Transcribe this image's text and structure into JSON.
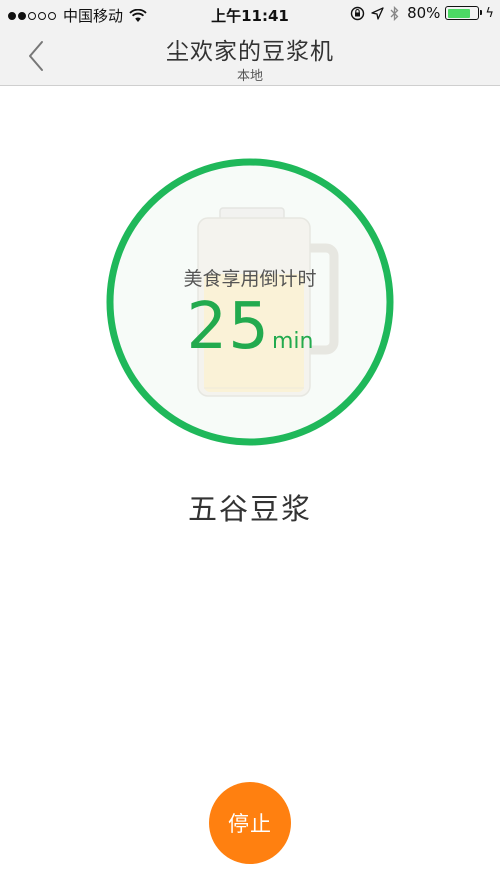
{
  "status_bar": {
    "carrier": "中国移动",
    "time": "上午11:41",
    "battery_percent": "80%",
    "battery_level": 0.8
  },
  "nav": {
    "title": "尘欢家的豆浆机",
    "subtitle": "本地"
  },
  "timer": {
    "caption": "美食享用倒计时",
    "value": "25",
    "unit": "min"
  },
  "recipe": {
    "name": "五谷豆浆"
  },
  "actions": {
    "stop_label": "停止"
  },
  "colors": {
    "accent_green": "#1fb85a",
    "stop_orange": "#ff8010"
  }
}
